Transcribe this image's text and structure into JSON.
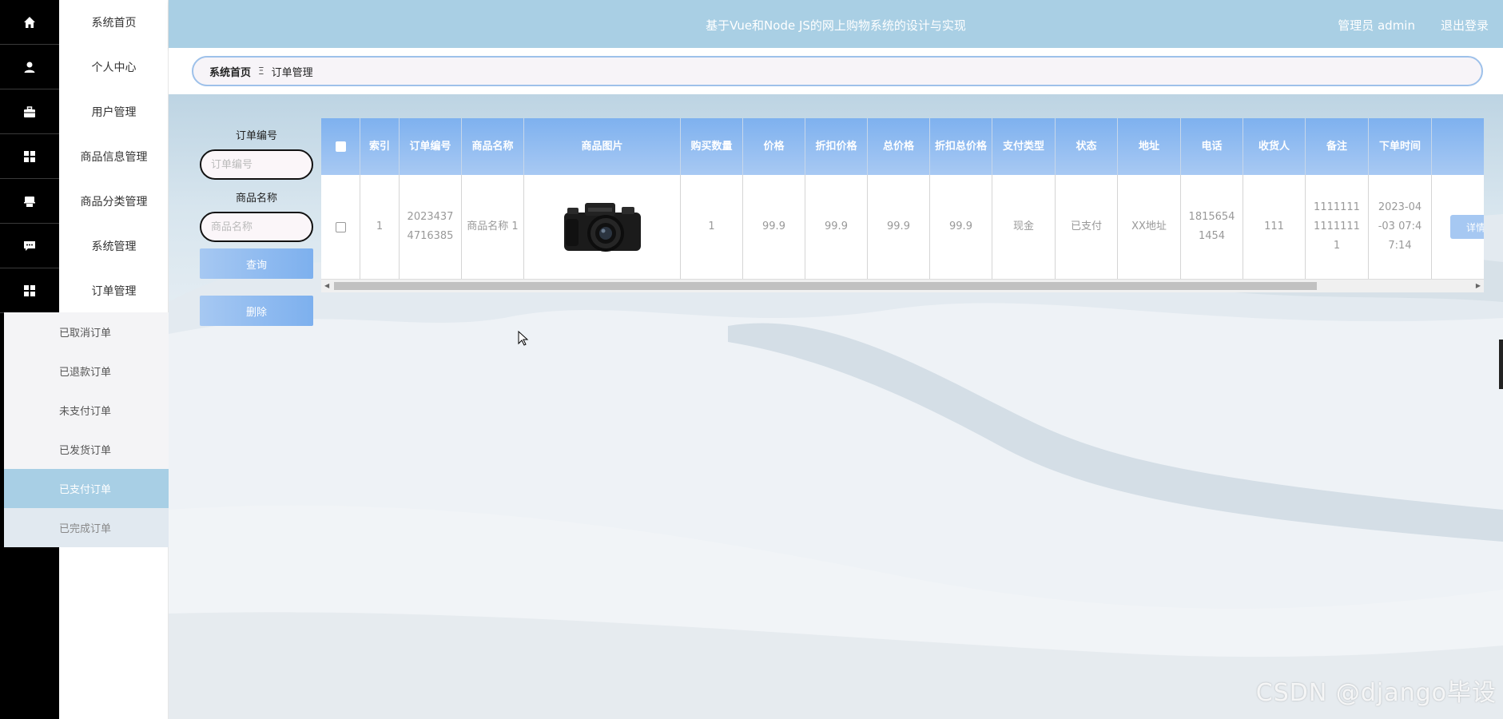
{
  "header": {
    "title": "基于Vue和Node JS的网上购物系统的设计与实现",
    "user": "管理员 admin",
    "logout": "退出登录"
  },
  "sidebar": {
    "items": [
      {
        "label": "系统首页",
        "icon": "home-icon"
      },
      {
        "label": "个人中心",
        "icon": "user-icon"
      },
      {
        "label": "用户管理",
        "icon": "briefcase-icon"
      },
      {
        "label": "商品信息管理",
        "icon": "grid-icon"
      },
      {
        "label": "商品分类管理",
        "icon": "printer-icon"
      },
      {
        "label": "系统管理",
        "icon": "chat-icon"
      },
      {
        "label": "订单管理",
        "icon": "grid-icon"
      }
    ],
    "submenu": [
      {
        "label": "已取消订单"
      },
      {
        "label": "已退款订单"
      },
      {
        "label": "未支付订单"
      },
      {
        "label": "已发货订单"
      },
      {
        "label": "已支付订单",
        "active": true
      },
      {
        "label": "已完成订单"
      }
    ]
  },
  "breadcrumb": {
    "home": "系统首页",
    "separator": "Ξ",
    "current": "订单管理"
  },
  "search": {
    "order_no_label": "订单编号",
    "order_no_placeholder": "订单编号",
    "product_label": "商品名称",
    "product_placeholder": "商品名称",
    "query_button": "查询",
    "delete_button": "删除"
  },
  "table": {
    "columns": [
      "索引",
      "订单编号",
      "商品名称",
      "商品图片",
      "购买数量",
      "价格",
      "折扣价格",
      "总价格",
      "折扣总价格",
      "支付类型",
      "状态",
      "地址",
      "电话",
      "收货人",
      "备注",
      "下单时间"
    ],
    "rows": [
      {
        "index": "1",
        "order_no": "2023437 4716385",
        "product_name": "商品名称 1",
        "image": "camera-image",
        "quantity": "1",
        "price": "99.9",
        "discount_price": "99.9",
        "total_price": "99.9",
        "discount_total": "99.9",
        "pay_type": "现金",
        "status": "已支付",
        "address": "XX地址",
        "phone": "1815654 1454",
        "receiver": "111",
        "remark": "1111111 1111111 1",
        "order_time": "2023-04 -03 07:4 7:14",
        "action": "详情"
      }
    ]
  },
  "watermark": "CSDN @django毕设",
  "colors": {
    "topbar": "#a9cfe4",
    "table_header": "#7eb1ef",
    "active_submenu": "#a8cfe5",
    "sidebar_icons_bg": "#000000"
  }
}
